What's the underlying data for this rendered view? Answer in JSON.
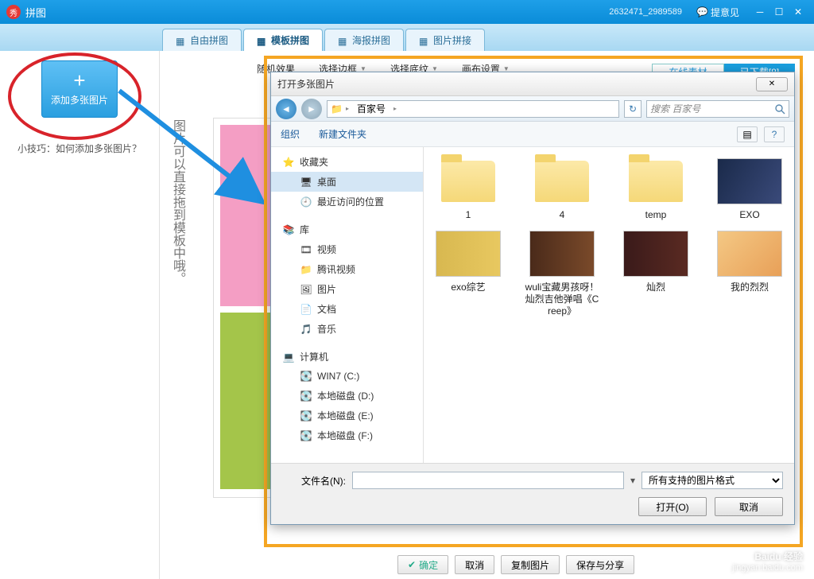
{
  "app": {
    "title": "拼图",
    "user_id": "2632471_2989589",
    "feedback": "提意见"
  },
  "tabs": [
    {
      "label": "自由拼图"
    },
    {
      "label": "模板拼图"
    },
    {
      "label": "海报拼图"
    },
    {
      "label": "图片拼接"
    }
  ],
  "sidebar": {
    "add_label": "添加多张图片",
    "tip": "小技巧：如何添加多张图片？"
  },
  "canvas": {
    "tools": {
      "random": "随机效果",
      "border": "选择边框",
      "texture": "选择底纹",
      "canvas_setting": "画布设置"
    },
    "ribbon_left": "在线素材",
    "ribbon_right": "已下载[8]",
    "side_text": "图片可以直接拖到模板中哦。"
  },
  "bottom": {
    "ok": "确定",
    "cancel": "取消",
    "copy": "复制图片",
    "save": "保存与分享"
  },
  "dialog": {
    "title": "打开多张图片",
    "breadcrumb_folder": "百家号",
    "search_placeholder": "搜索 百家号",
    "toolbar": {
      "organize": "组织",
      "newfolder": "新建文件夹"
    },
    "tree": {
      "favorites": "收藏夹",
      "desktop": "桌面",
      "recent": "最近访问的位置",
      "libraries": "库",
      "videos": "视频",
      "tencent": "腾讯视频",
      "pictures": "图片",
      "documents": "文档",
      "music": "音乐",
      "computer": "计算机",
      "c": "WIN7 (C:)",
      "d": "本地磁盘 (D:)",
      "e": "本地磁盘 (E:)",
      "f": "本地磁盘 (F:)"
    },
    "files": [
      {
        "name": "1",
        "type": "folder"
      },
      {
        "name": "4",
        "type": "folder"
      },
      {
        "name": "temp",
        "type": "folder"
      },
      {
        "name": "EXO",
        "type": "image",
        "bg": "linear-gradient(120deg,#1a2a4a,#3a4a7a)"
      },
      {
        "name": "exo综艺",
        "type": "image",
        "bg": "linear-gradient(90deg,#d8b850,#e8c860)"
      },
      {
        "name": "wuli宝藏男孩呀！灿烈吉他弹唱《Creep》",
        "type": "image",
        "bg": "linear-gradient(90deg,#4a2a1a,#7a4a2a)"
      },
      {
        "name": "灿烈",
        "type": "image",
        "bg": "linear-gradient(90deg,#3a1a1a,#5a2a22)"
      },
      {
        "name": "我的烈烈",
        "type": "image",
        "bg": "linear-gradient(135deg,#f4c884,#e8a058)"
      }
    ],
    "footer": {
      "filename_label": "文件名(N):",
      "filter": "所有支持的图片格式",
      "open": "打开(O)",
      "cancel": "取消"
    }
  },
  "watermark": {
    "brand": "Baidu 经验",
    "url": "jingyan.baidu.com"
  }
}
